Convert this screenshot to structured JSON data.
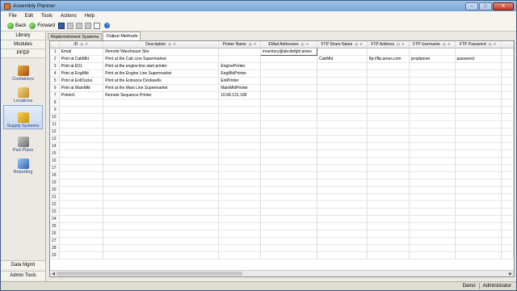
{
  "window": {
    "title": "Assembly Planner",
    "min_glyph": "–",
    "max_glyph": "□",
    "close_glyph": "✕"
  },
  "menu": [
    "File",
    "Edit",
    "Tools",
    "Actions",
    "Help"
  ],
  "toolbar": {
    "back_label": "Back",
    "forward_label": "Forward",
    "help_glyph": "?"
  },
  "sidebar": {
    "top_items": [
      "Library",
      "Modules",
      "PFEP"
    ],
    "items": [
      {
        "label": "Containers",
        "icon": "containers-icon",
        "selected": false
      },
      {
        "label": "Locations",
        "icon": "locations-icon",
        "selected": false
      },
      {
        "label": "Supply Systems",
        "icon": "supply-systems-icon",
        "selected": true
      },
      {
        "label": "Part Plans",
        "icon": "part-plans-icon",
        "selected": false
      },
      {
        "label": "Reporting",
        "icon": "reporting-icon",
        "selected": false
      }
    ],
    "bottom_items": [
      "Data Mgmt",
      "Admin Tools"
    ]
  },
  "tabs": [
    {
      "label": "Replenishment Systems",
      "active": false
    },
    {
      "label": "Output Methods",
      "active": true
    }
  ],
  "grid": {
    "columns": [
      "ID",
      "Description",
      "Printer Name",
      "EMail Addresses",
      "FTP Share Name",
      "FTP Address",
      "FTP Username",
      "FTP Password"
    ],
    "filter_glyph": "◇",
    "check_glyph": "✓",
    "rows": [
      [
        "Email",
        "Remote Warehouse Site",
        "",
        "inventory@abcdefghi.ames",
        "",
        "",
        "",
        ""
      ],
      [
        "Print at CabMkt",
        "Print at the Cab Line Supermarket",
        "",
        "",
        "CabMkt",
        "ftp://ftp.ames.com",
        "proplanner",
        "password"
      ],
      [
        "Print at E01",
        "Print at the engine line start printer",
        "EnginePrinter",
        "",
        "",
        "",
        "",
        ""
      ],
      [
        "Print at EngMkt",
        "Print at the Engine Line Supermarket",
        "EngMktPrinter",
        "",
        "",
        "",
        "",
        ""
      ],
      [
        "Print at EntDocks",
        "Print at the Entrance Dockwells",
        "EntPrinter",
        "",
        "",
        "",
        "",
        ""
      ],
      [
        "Print at MainMkt",
        "Print at the Main Line Supermarket",
        "MainMktPrinter",
        "",
        "",
        "",
        "",
        ""
      ],
      [
        "Printer1",
        "Remote Sequence Printer",
        "10.68.131.108",
        "",
        "",
        "",
        "",
        ""
      ]
    ],
    "row_numbers": [
      "1",
      "2",
      "3",
      "4",
      "5",
      "6",
      "7",
      "8",
      "9",
      "10",
      "11",
      "12",
      "13",
      "14",
      "15",
      "16",
      "17",
      "18",
      "19",
      "20",
      "21",
      "22",
      "23",
      "24",
      "25",
      "26",
      "27",
      "28",
      "29"
    ],
    "scroll_left": "◀",
    "scroll_right": "▶"
  },
  "status": {
    "left": "Demo",
    "right": "Administrator"
  }
}
